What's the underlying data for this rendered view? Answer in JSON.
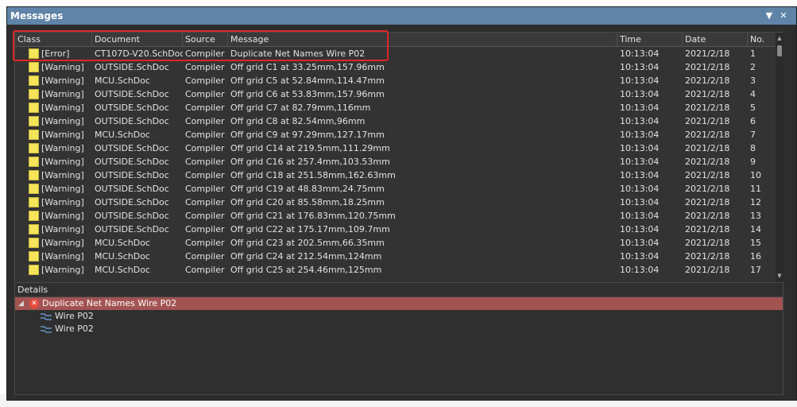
{
  "window": {
    "title": "Messages",
    "menu_icon": "dropdown-arrow-icon",
    "close_icon": "close-icon"
  },
  "table": {
    "columns": [
      "Class",
      "Document",
      "Source",
      "Message",
      "Time",
      "Date",
      "No."
    ],
    "rows": [
      {
        "class": "[Error]",
        "document": "CT107D-V20.SchDoc",
        "source": "Compiler",
        "message": "Duplicate Net Names Wire P02",
        "time": "10:13:04",
        "date": "2021/2/18",
        "no": "1"
      },
      {
        "class": "[Warning]",
        "document": "OUTSIDE.SchDoc",
        "source": "Compiler",
        "message": "Off grid C1 at 33.25mm,157.96mm",
        "time": "10:13:04",
        "date": "2021/2/18",
        "no": "2"
      },
      {
        "class": "[Warning]",
        "document": "MCU.SchDoc",
        "source": "Compiler",
        "message": "Off grid C5 at 52.84mm,114.47mm",
        "time": "10:13:04",
        "date": "2021/2/18",
        "no": "3"
      },
      {
        "class": "[Warning]",
        "document": "OUTSIDE.SchDoc",
        "source": "Compiler",
        "message": "Off grid C6 at 53.83mm,157.96mm",
        "time": "10:13:04",
        "date": "2021/2/18",
        "no": "4"
      },
      {
        "class": "[Warning]",
        "document": "OUTSIDE.SchDoc",
        "source": "Compiler",
        "message": "Off grid C7 at 82.79mm,116mm",
        "time": "10:13:04",
        "date": "2021/2/18",
        "no": "5"
      },
      {
        "class": "[Warning]",
        "document": "OUTSIDE.SchDoc",
        "source": "Compiler",
        "message": "Off grid C8 at 82.54mm,96mm",
        "time": "10:13:04",
        "date": "2021/2/18",
        "no": "6"
      },
      {
        "class": "[Warning]",
        "document": "MCU.SchDoc",
        "source": "Compiler",
        "message": "Off grid C9 at 97.29mm,127.17mm",
        "time": "10:13:04",
        "date": "2021/2/18",
        "no": "7"
      },
      {
        "class": "[Warning]",
        "document": "OUTSIDE.SchDoc",
        "source": "Compiler",
        "message": "Off grid C14 at 219.5mm,111.29mm",
        "time": "10:13:04",
        "date": "2021/2/18",
        "no": "8"
      },
      {
        "class": "[Warning]",
        "document": "OUTSIDE.SchDoc",
        "source": "Compiler",
        "message": "Off grid C16 at 257.4mm,103.53mm",
        "time": "10:13:04",
        "date": "2021/2/18",
        "no": "9"
      },
      {
        "class": "[Warning]",
        "document": "OUTSIDE.SchDoc",
        "source": "Compiler",
        "message": "Off grid C18 at 251.58mm,162.63mm",
        "time": "10:13:04",
        "date": "2021/2/18",
        "no": "10"
      },
      {
        "class": "[Warning]",
        "document": "OUTSIDE.SchDoc",
        "source": "Compiler",
        "message": "Off grid C19 at 48.83mm,24.75mm",
        "time": "10:13:04",
        "date": "2021/2/18",
        "no": "11"
      },
      {
        "class": "[Warning]",
        "document": "OUTSIDE.SchDoc",
        "source": "Compiler",
        "message": "Off grid C20 at 85.58mm,18.25mm",
        "time": "10:13:04",
        "date": "2021/2/18",
        "no": "12"
      },
      {
        "class": "[Warning]",
        "document": "OUTSIDE.SchDoc",
        "source": "Compiler",
        "message": "Off grid C21 at 176.83mm,120.75mm",
        "time": "10:13:04",
        "date": "2021/2/18",
        "no": "13"
      },
      {
        "class": "[Warning]",
        "document": "OUTSIDE.SchDoc",
        "source": "Compiler",
        "message": "Off grid C22 at 175.17mm,109.7mm",
        "time": "10:13:04",
        "date": "2021/2/18",
        "no": "14"
      },
      {
        "class": "[Warning]",
        "document": "MCU.SchDoc",
        "source": "Compiler",
        "message": "Off grid C23 at 202.5mm,66.35mm",
        "time": "10:13:04",
        "date": "2021/2/18",
        "no": "15"
      },
      {
        "class": "[Warning]",
        "document": "MCU.SchDoc",
        "source": "Compiler",
        "message": "Off grid C24 at 212.54mm,124mm",
        "time": "10:13:04",
        "date": "2021/2/18",
        "no": "16"
      },
      {
        "class": "[Warning]",
        "document": "MCU.SchDoc",
        "source": "Compiler",
        "message": "Off grid C25 at 254.46mm,125mm",
        "time": "10:13:04",
        "date": "2021/2/18",
        "no": "17"
      }
    ]
  },
  "details": {
    "label": "Details",
    "selected": "Duplicate Net Names Wire P02",
    "children": [
      "Wire P02",
      "Wire P02"
    ]
  },
  "colors": {
    "title_bar": "#5f84a8",
    "selected_detail": "#a25352",
    "highlight": "#e02525",
    "class_icon": "#f5e35a"
  }
}
